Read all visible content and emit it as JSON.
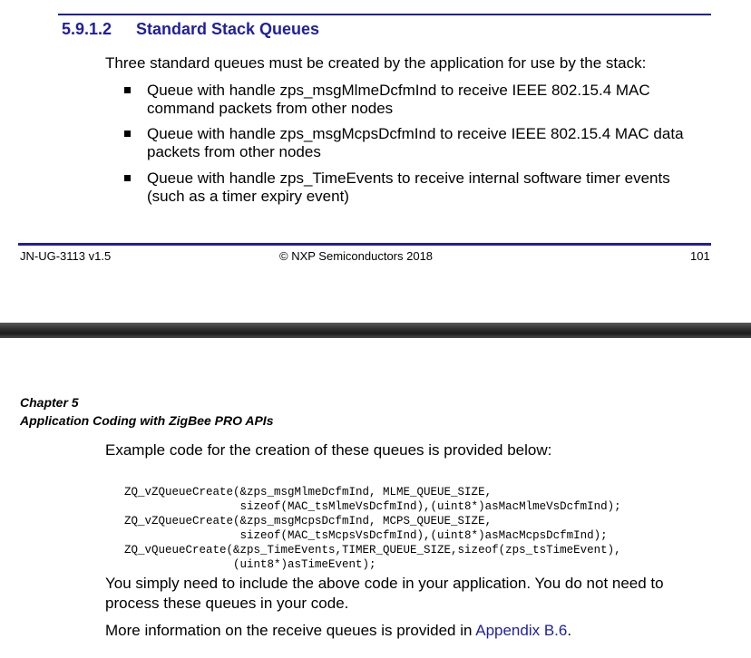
{
  "section": {
    "number": "5.9.1.2",
    "title": "Standard Stack Queues"
  },
  "intro": "Three standard queues must be created by the application for use by the stack:",
  "bullets": [
    {
      "line1": "Queue with handle zps_msgMlmeDcfmInd to receive IEEE 802.15.4 MAC",
      "line2": "command packets from other nodes"
    },
    {
      "line1": "Queue with handle zps_msgMcpsDcfmInd to receive IEEE 802.15.4 MAC data",
      "line2": "packets from other nodes"
    },
    {
      "line1": "Queue with handle zps_TimeEvents to receive internal software timer events",
      "line2": "(such as a timer expiry event)"
    }
  ],
  "footer": {
    "doc_id": "JN-UG-3113 v1.5",
    "copyright": "© NXP Semiconductors 2018",
    "page": "101"
  },
  "chapter": {
    "label": "Chapter 5",
    "title": "Application Coding with ZigBee PRO APIs"
  },
  "example_intro": "Example code for the creation of these queues is provided below:",
  "code_lines": [
    "ZQ_vZQueueCreate(&zps_msgMlmeDcfmInd, MLME_QUEUE_SIZE,",
    "                 sizeof(MAC_tsMlmeVsDcfmInd),(uint8*)asMacMlmeVsDcfmInd);",
    "ZQ_vZQueueCreate(&zps_msgMcpsDcfmInd, MCPS_QUEUE_SIZE,",
    "                 sizeof(MAC_tsMcpsVsDcfmInd),(uint8*)asMacMcpsDcfmInd);",
    "ZQ_vQueueCreate(&zps_TimeEvents,TIMER_QUEUE_SIZE,sizeof(zps_tsTimeEvent),",
    "                (uint8*)asTimeEvent);"
  ],
  "closing_line1": "You simply need to include the above code in your application. You do not need to",
  "closing_line2": "process these queues in your code.",
  "more_info_prefix": "More information on the receive queues is provided in ",
  "more_info_link": "Appendix B.6",
  "more_info_suffix": "."
}
